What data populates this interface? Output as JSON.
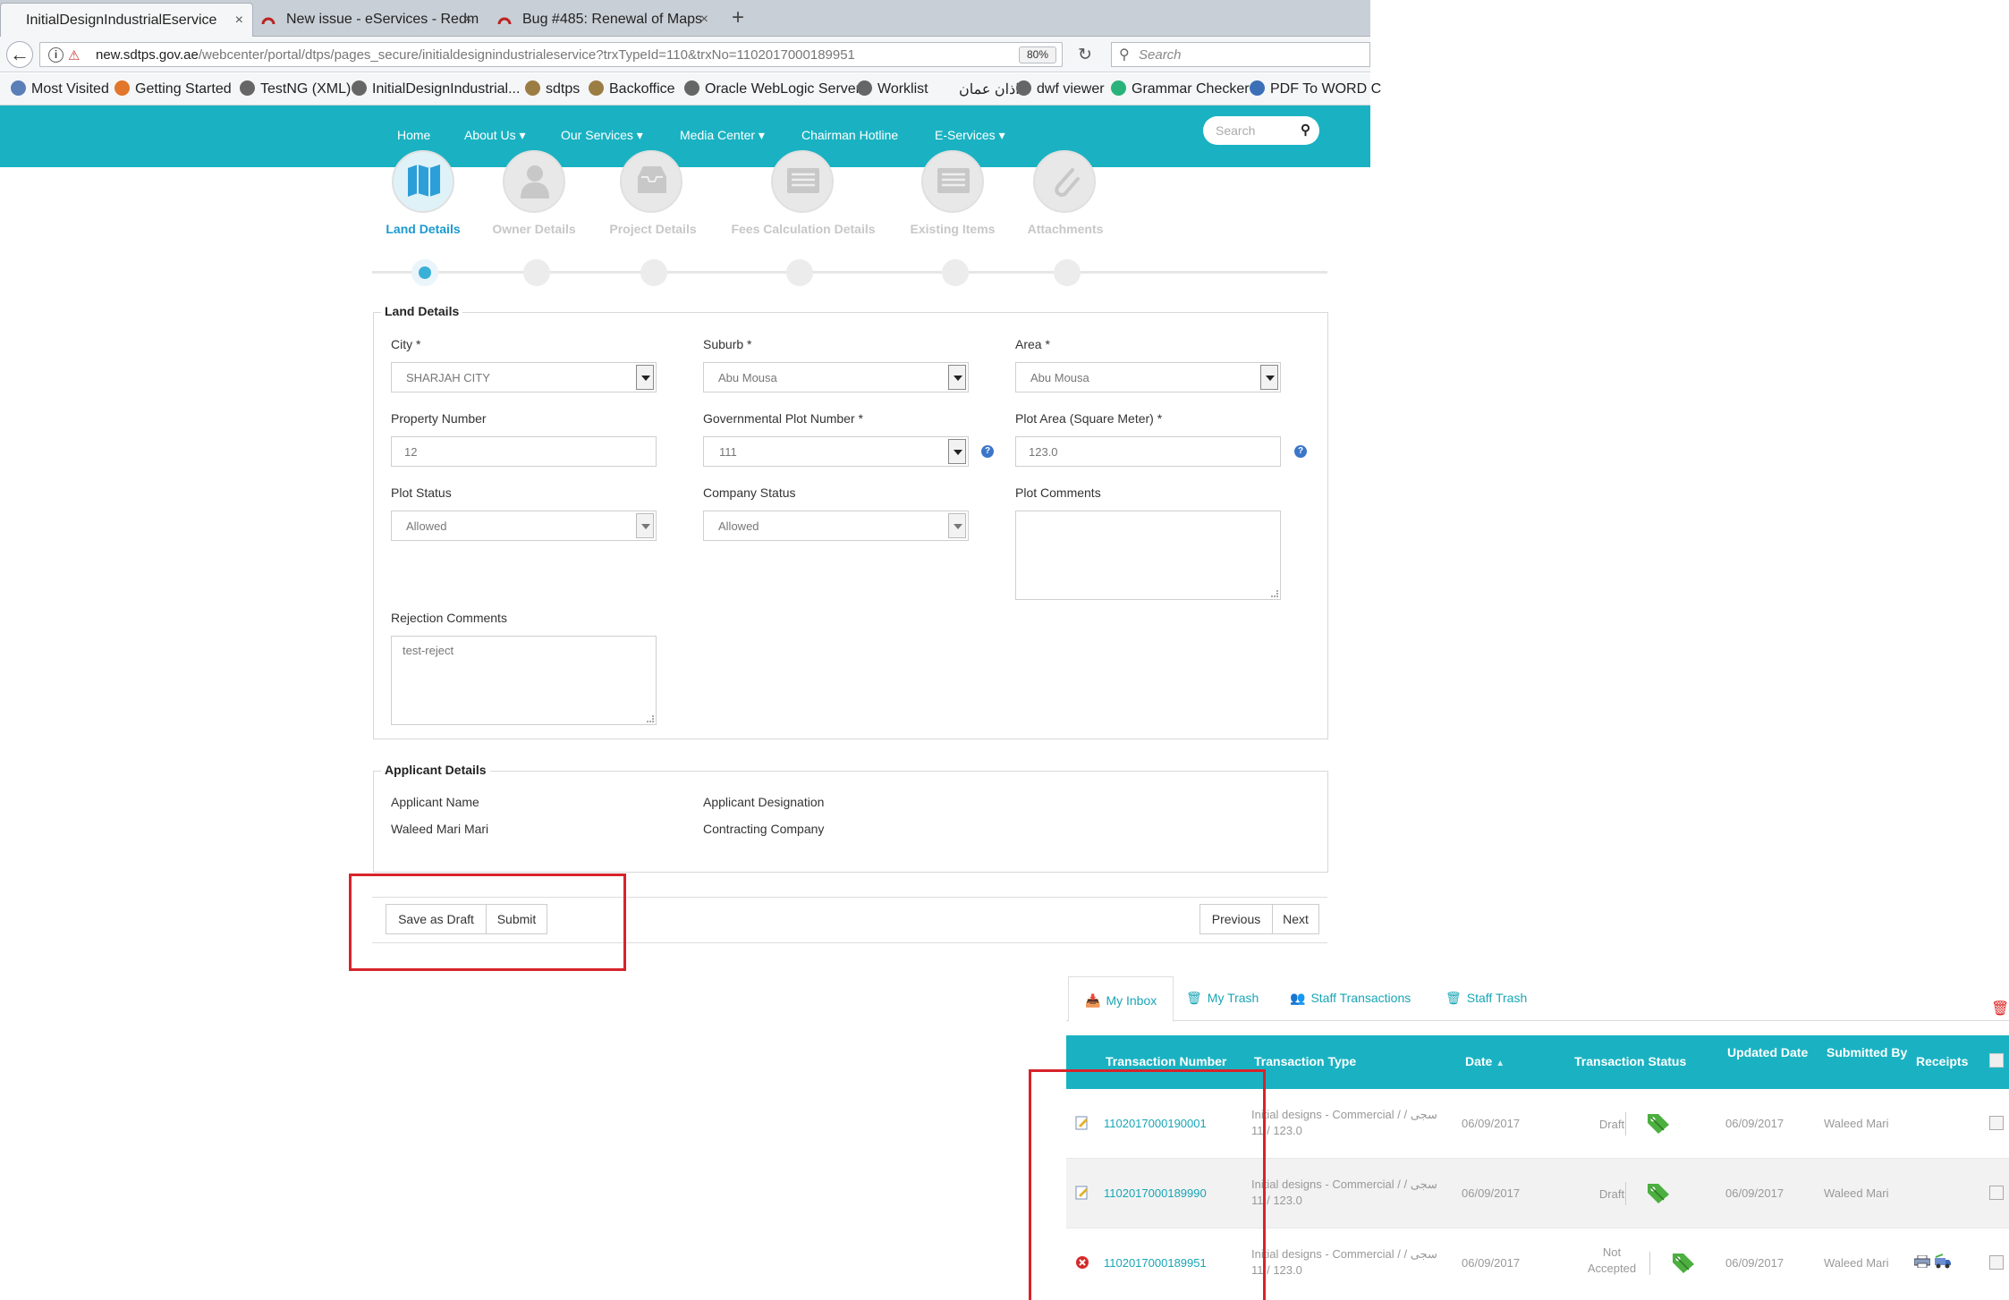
{
  "browser": {
    "tabs": [
      {
        "label": "InitialDesignIndustrialEservice",
        "close": "×"
      },
      {
        "label": "New issue - eServices - Redm",
        "close": "×"
      },
      {
        "label": "Bug #485: Renewal of Maps",
        "close": "×"
      }
    ],
    "new_tab": "+",
    "url_domain": "new.sdtps.gov.ae",
    "url_rest": "/webcenter/portal/dtps/pages_secure/initialdesignindustrialeservice?trxTypeId=110&trxNo=1102017000189951",
    "url_prefix": "new.",
    "zoom": "80%",
    "search_placeholder": "Search",
    "bookmarks": [
      {
        "label": "Most Visited",
        "color": "#5a7fb8"
      },
      {
        "label": "Getting Started",
        "color": "#e2762a"
      },
      {
        "label": "TestNG (XML)",
        "color": "#666666"
      },
      {
        "label": "InitialDesignIndustrial...",
        "color": "#666666"
      },
      {
        "label": "sdtps",
        "color": "#9b7d43"
      },
      {
        "label": "Backoffice",
        "color": "#9b7d43"
      },
      {
        "label": "Oracle WebLogic Server",
        "color": "#666666"
      },
      {
        "label": "Worklist",
        "color": "#666666"
      },
      {
        "label": "اذان عمان",
        "color": "#ffffff"
      },
      {
        "label": "dwf viewer",
        "color": "#666666"
      },
      {
        "label": "Grammar Checker",
        "color": "#2ab27b"
      },
      {
        "label": "PDF To WORD C",
        "color": "#3b6fb6"
      }
    ]
  },
  "site": {
    "nav": [
      "Home",
      "About Us",
      "Our Services",
      "Media Center",
      "Chairman Hotline",
      "E-Services"
    ],
    "search_placeholder": "Search",
    "accent": "#1ab2c2"
  },
  "wizard": {
    "steps": [
      "Land Details",
      "Owner Details",
      "Project Details",
      "Fees Calculation Details",
      "Existing Items",
      "Attachments"
    ],
    "active": "Land Details"
  },
  "land": {
    "legend": "Land Details",
    "city_label": "City *",
    "city_value": "SHARJAH CITY",
    "suburb_label": "Suburb *",
    "suburb_value": "Abu Mousa",
    "area_label": "Area *",
    "area_value": "Abu Mousa",
    "property_label": "Property Number",
    "property_value": "12",
    "gov_plot_label": "Governmental Plot Number *",
    "gov_plot_value": "111",
    "plot_area_label": "Plot Area (Square Meter) *",
    "plot_area_value": "123.0",
    "plot_status_label": "Plot Status",
    "plot_status_value": "Allowed",
    "company_status_label": "Company Status",
    "company_status_value": "Allowed",
    "plot_comments_label": "Plot Comments",
    "rejection_label": "Rejection Comments",
    "rejection_value": "test-reject"
  },
  "applicant": {
    "legend": "Applicant Details",
    "name_label": "Applicant Name",
    "name_value": "Waleed Mari Mari",
    "designation_label": "Applicant Designation",
    "designation_value": "Contracting Company"
  },
  "actions": {
    "save_draft": "Save as Draft",
    "submit": "Submit",
    "previous": "Previous",
    "next": "Next"
  },
  "inbox": {
    "tabs": [
      "My Inbox",
      "My Trash",
      "Staff Transactions",
      "Staff Trash"
    ],
    "columns": {
      "number": "Transaction Number",
      "type": "Transaction Type",
      "date": "Date",
      "date_sort": "▲",
      "status": "Transaction Status",
      "updated": "Updated Date",
      "submitted": "Submitted By",
      "receipts": "Receipts"
    },
    "rows": [
      {
        "number": "1102017000190001",
        "type": "Initial designs - Commercial / / سجى",
        "type2": "11 / 123.0",
        "date": "06/09/2017",
        "status": "Draft",
        "updated": "06/09/2017",
        "submitted": "Waleed Mari",
        "icon": "edit"
      },
      {
        "number": "1102017000189990",
        "type": "Initial designs - Commercial / / سجى",
        "type2": "11 / 123.0",
        "date": "06/09/2017",
        "status": "Draft",
        "updated": "06/09/2017",
        "submitted": "Waleed Mari",
        "icon": "edit"
      },
      {
        "number": "1102017000189951",
        "type": "Initial designs - Commercial / / سجى",
        "type2": "11 / 123.0",
        "date": "06/09/2017",
        "status": "Not Accepted",
        "status_line1": "Not",
        "status_line2": "Accepted",
        "updated": "06/09/2017",
        "submitted": "Waleed Mari",
        "icon": "rejected"
      }
    ]
  }
}
